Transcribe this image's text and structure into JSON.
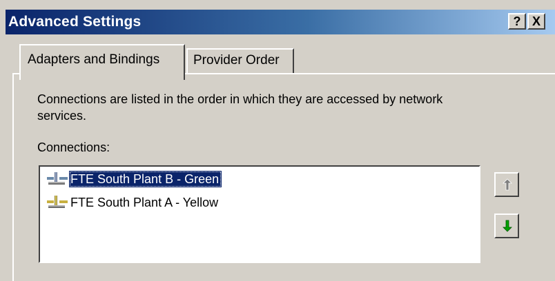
{
  "window": {
    "title": "Advanced Settings",
    "help_label": "?",
    "close_label": "X"
  },
  "tabs": [
    {
      "label": "Adapters and Bindings",
      "active": true
    },
    {
      "label": "Provider Order",
      "active": false
    }
  ],
  "panel": {
    "description": "Connections are listed in the order in which they are accessed by network services.",
    "connections_label": "Connections:",
    "connections": [
      {
        "label": "FTE South Plant B - Green",
        "selected": true,
        "icon": "network-adapter-icon"
      },
      {
        "label": "FTE South Plant A - Yellow",
        "selected": false,
        "icon": "network-adapter-icon"
      }
    ]
  },
  "buttons": {
    "move_up": {
      "icon": "up-arrow-icon",
      "enabled": false,
      "color": "#808080"
    },
    "move_down": {
      "icon": "down-arrow-icon",
      "enabled": true,
      "color": "#00a000"
    }
  },
  "colors": {
    "selection": "#0a246a",
    "dialog": "#d4d0c8",
    "title_start": "#0a246a",
    "title_end": "#a6caf0"
  }
}
